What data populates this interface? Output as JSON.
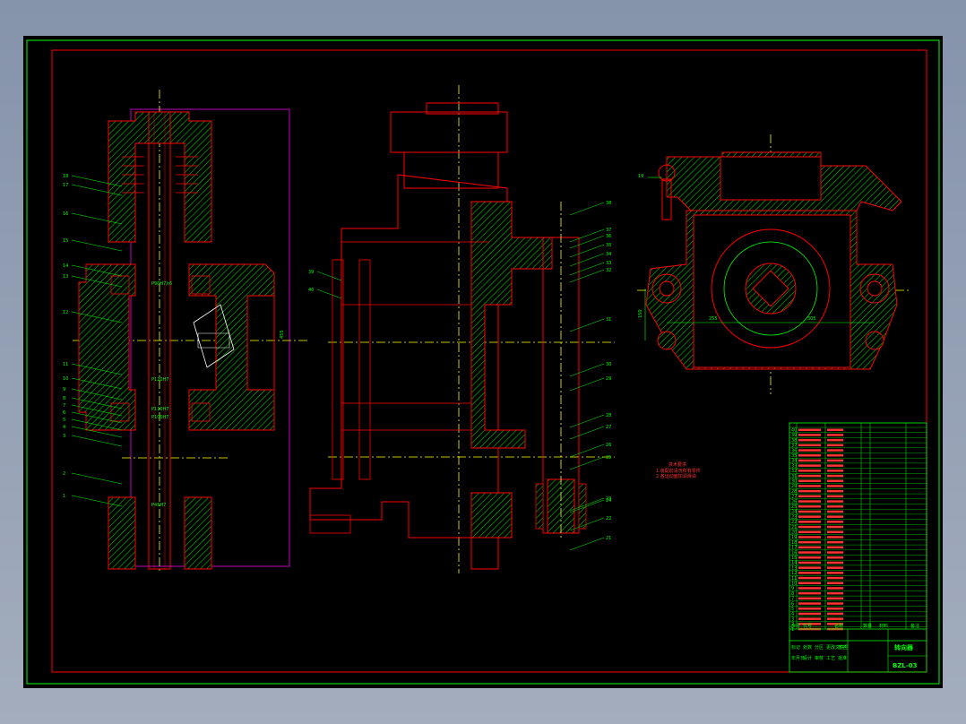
{
  "drawing": {
    "background": "#000000",
    "colors": {
      "frame": "#00ff00",
      "outline": "#ff0000",
      "centerline": "#ffff00",
      "hatch": "#00cc00",
      "dimension": "#00ff00",
      "boundary": "#c000c0",
      "white": "#ffffff"
    },
    "left_view_balloons": [
      "18",
      "17",
      "16",
      "15",
      "14",
      "13",
      "12",
      "11",
      "10",
      "9",
      "8",
      "7",
      "6",
      "5",
      "4",
      "3",
      "2",
      "1"
    ],
    "middle_view_balloons_left": [
      "39",
      "40"
    ],
    "middle_view_balloons_right": [
      "38",
      "37",
      "36",
      "35",
      "34",
      "33",
      "32",
      "31",
      "30",
      "29",
      "28",
      "27",
      "26",
      "25",
      "24",
      "23",
      "22",
      "21"
    ],
    "right_view_balloons": [
      "19"
    ],
    "dimensions": {
      "right_left": "255",
      "right_right": "305",
      "right_height": "150",
      "left_vertical": "455"
    },
    "fits": [
      "P90H7/r6",
      "P120H7",
      "P110H7",
      "P100H7",
      "P45H7"
    ],
    "notes_title": "技术要求",
    "notes": [
      "1.装配前清洗所有零件",
      "2.各运动面加润滑油"
    ],
    "title_block": {
      "title": "转向器",
      "drawing_no": "BZL-03",
      "columns": [
        "序号",
        "代号",
        "名称",
        "数量",
        "材料",
        "备注"
      ],
      "labels": [
        "标记",
        "处数",
        "分区",
        "更改文件号",
        "签名",
        "年月日",
        "设计",
        "审核",
        "工艺",
        "批准"
      ]
    }
  }
}
